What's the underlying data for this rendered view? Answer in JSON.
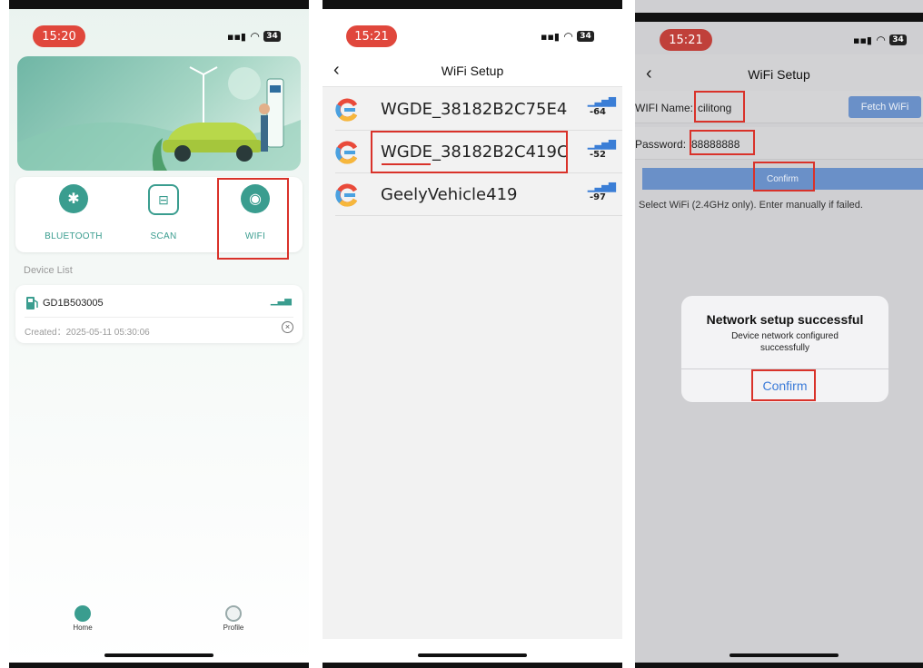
{
  "colors": {
    "accent_teal": "#3a9d8f",
    "highlight_red": "#d9322a",
    "time_pill": "#e0473c",
    "ios_blue": "#3a7ad8"
  },
  "screen1": {
    "time": "15:20",
    "battery": "34",
    "actions": [
      {
        "label": "BLUETOOTH",
        "icon": "bluetooth-icon"
      },
      {
        "label": "SCAN",
        "icon": "scan-icon"
      },
      {
        "label": "WIFI",
        "icon": "wifi-icon"
      }
    ],
    "device_list_title": "Device List",
    "device": {
      "name": "GD1B503005",
      "created": "Created：2025-05-11 05:30:06"
    },
    "tabbar": [
      {
        "label": "Home",
        "icon": "home-icon"
      },
      {
        "label": "Profile",
        "icon": "profile-icon"
      }
    ]
  },
  "screen2": {
    "time": "15:21",
    "battery": "34",
    "title": "WiFi Setup",
    "networks": [
      {
        "name": "WGDE_38182B2C75E4",
        "signal": "-64"
      },
      {
        "name": "WGDE_38182B2C419C",
        "signal": "-52"
      },
      {
        "name": "GeelyVehicle419",
        "signal": "-97"
      }
    ]
  },
  "screen3": {
    "time": "15:21",
    "battery": "34",
    "title": "WiFi Setup",
    "wifi_name_label": "WIFI Name:",
    "wifi_name_value": "cilitong",
    "fetch_button": "Fetch WiFi",
    "password_label": "Password:",
    "password_value": "88888888",
    "confirm_button": "Confirm",
    "hint": "Select WiFi (2.4GHz only). Enter manually if failed.",
    "dialog": {
      "title": "Network setup successful",
      "message": "Device network configured successfully",
      "button": "Confirm"
    }
  }
}
